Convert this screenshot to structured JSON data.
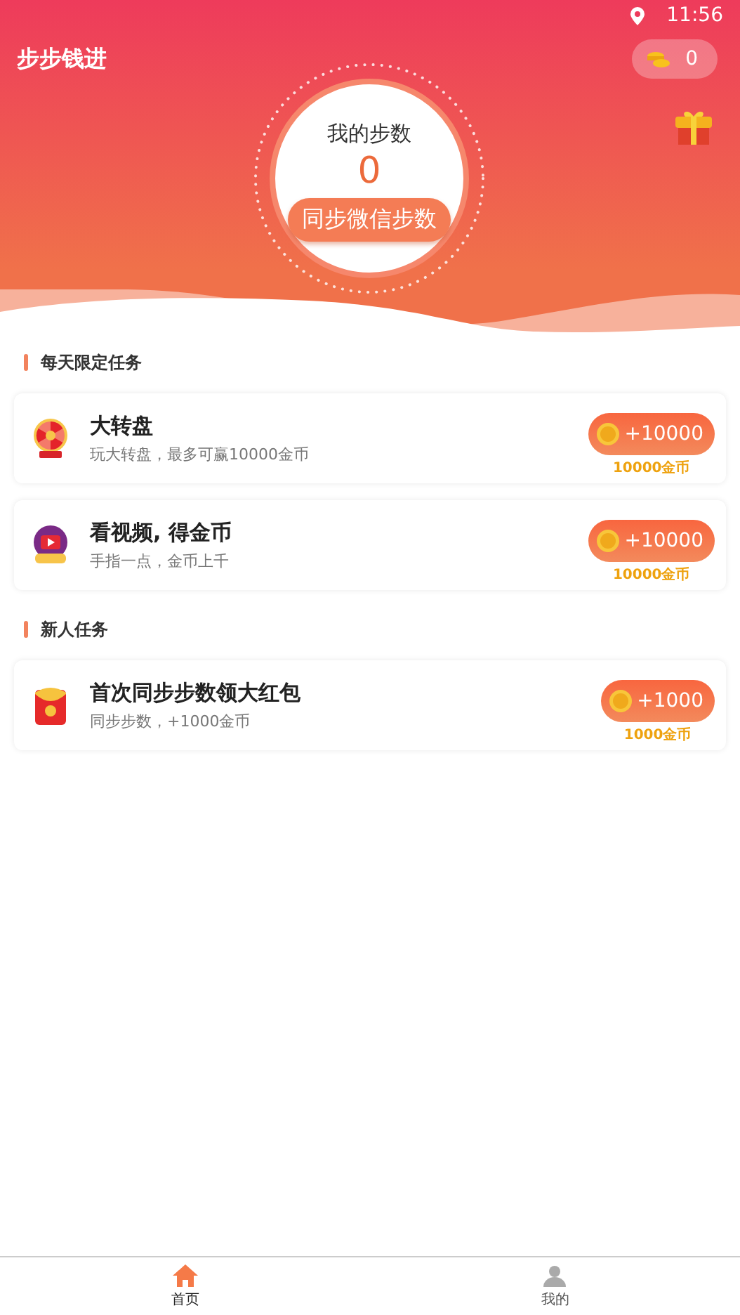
{
  "status_bar": {
    "time": "11:56"
  },
  "header": {
    "title": "步步钱进",
    "coins": "0"
  },
  "steps": {
    "label": "我的步数",
    "count": "0",
    "sync_button": "同步微信步数"
  },
  "sections": [
    {
      "title": "每天限定任务",
      "tasks": [
        {
          "kind": "wheel",
          "title": "大转盘",
          "subtitle": "玩大转盘，最多可赢10000金币",
          "reward": "+10000",
          "reward_note": "10000金币"
        },
        {
          "kind": "video",
          "title": "看视频, 得金币",
          "subtitle": "手指一点，金币上千",
          "reward": "+10000",
          "reward_note": "10000金币"
        }
      ]
    },
    {
      "title": "新人任务",
      "tasks": [
        {
          "kind": "redpacket",
          "title": "首次同步步数领大红包",
          "subtitle": "同步步数，+1000金币",
          "reward": "+1000",
          "reward_note": "1000金币"
        }
      ]
    }
  ],
  "tabs": [
    {
      "kind": "home",
      "label": "首页",
      "selected": true
    },
    {
      "kind": "profile",
      "label": "我的",
      "selected": false
    }
  ]
}
